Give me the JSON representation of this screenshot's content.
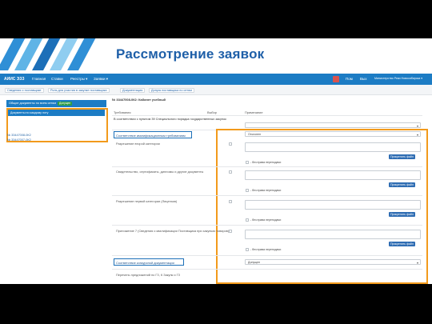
{
  "slide": {
    "title": "Рассмотрение заявок",
    "stripe_colors": [
      "#2f8fd6",
      "#5fb4e6",
      "#1c6fb8",
      "#8fcdf0",
      "#2f8fd6"
    ]
  },
  "navbar": {
    "logo": "АИИС ЭЗЗ",
    "items": [
      "Главная",
      "Ставки",
      "Реестры ▾",
      "Заявки ▾"
    ],
    "right_items": [
      "Пом",
      "Вых"
    ],
    "user": "Министерство Реки Новосибирска ▾"
  },
  "breadcrumbs": [
    "Сведения о поставщике",
    "Роль для участия в закупке поставщика",
    "Документация",
    "Допуск поставщика по сетям"
  ],
  "left_panel": {
    "header": "Общие документы по всем сетям",
    "header_badge": "Допущен",
    "sub_header": "Документы по каждому лоту",
    "lots": [
      "№ 33447008-0К2",
      "№ 33447007-0К2"
    ]
  },
  "main": {
    "lot_title": "№ 33447008-0К2: Кабинет учебный",
    "columns": {
      "requirement": "Требования",
      "choice": "Выбор",
      "note": "Примечание"
    },
    "first_row_text": "В соответствии с пунктом 39 Специального порядка государственных закупок",
    "section1": "Соответствие квалификационным требованиям",
    "section1_select": "Отклонен",
    "rows": [
      {
        "label": "Разрешение второй категории",
        "no_overwrite": "- без права переподачи",
        "attach": "Прикрепить файл"
      },
      {
        "label": "Свидетельство, сертификаты, дипломы и другие документы",
        "no_overwrite": "- без права переподачи",
        "attach": "Прикрепить файл"
      },
      {
        "label": "Разрешение первой категории (Лицензия)",
        "no_overwrite": "- без права переподачи",
        "attach": "Прикрепить файл"
      },
      {
        "label": "Приложение 7 (Сведения о квалификации Поставщика при закупках товаров)",
        "no_overwrite": "- без права переподачи",
        "attach": "Прикрепить файл"
      }
    ],
    "section2": "Соответствие конкурсной документации",
    "section2_select": "Допущен",
    "last_row_text": "Перечень предложений по ГЗ, К Закупк и ГЗ"
  }
}
